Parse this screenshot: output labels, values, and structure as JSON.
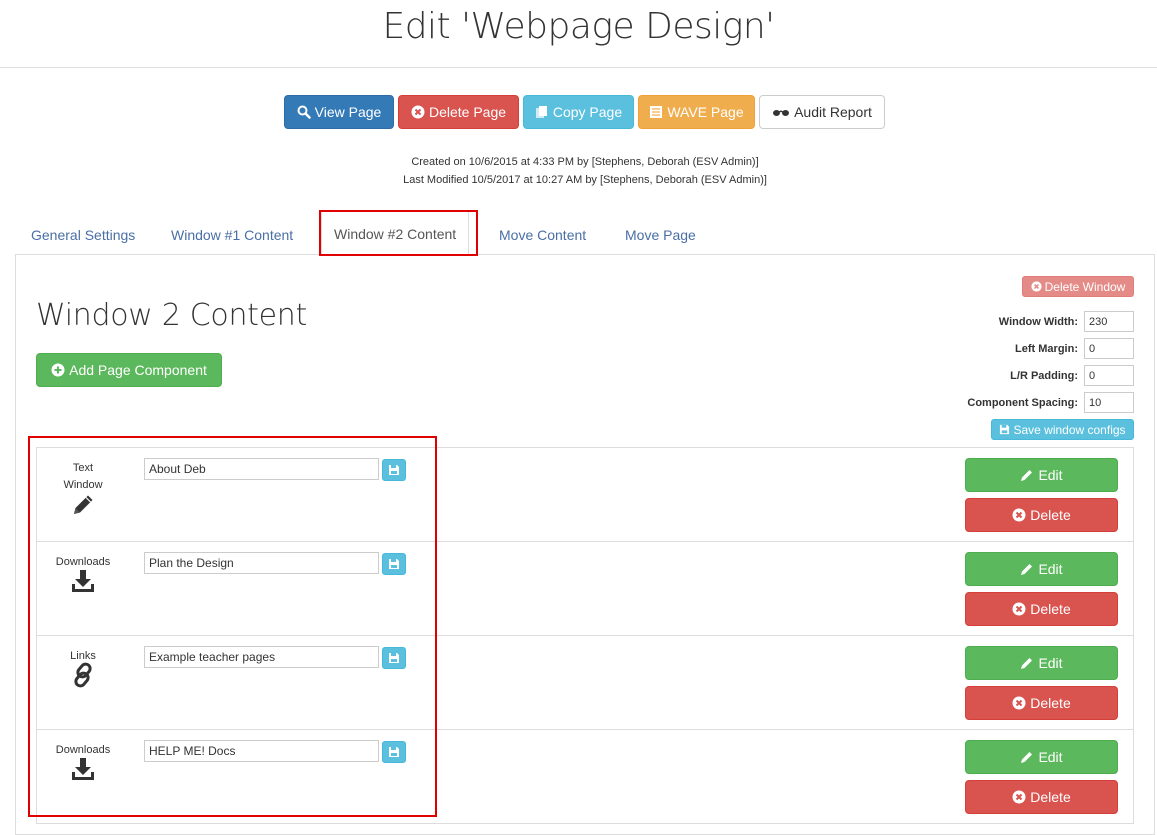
{
  "page": {
    "title": "Edit 'Webpage Design'"
  },
  "toolbar": {
    "view_page": "View Page",
    "delete_page": "Delete Page",
    "copy_page": "Copy Page",
    "wave_page": "WAVE Page",
    "audit_report": "Audit Report"
  },
  "meta": {
    "created": "Created on 10/6/2015 at 4:33 PM by [Stephens, Deborah (ESV Admin)]",
    "modified": "Last Modified 10/5/2017 at 10:27 AM by [Stephens, Deborah (ESV Admin)]"
  },
  "tabs": [
    {
      "label": "General Settings"
    },
    {
      "label": "Window #1 Content"
    },
    {
      "label": "Window #2 Content"
    },
    {
      "label": "Move Content"
    },
    {
      "label": "Move Page"
    }
  ],
  "window": {
    "title": "Window 2 Content",
    "add_component": "Add Page Component",
    "delete_window": "Delete Window",
    "width_label": "Window Width:",
    "width_value": "230",
    "margin_label": "Left Margin:",
    "margin_value": "0",
    "padding_label": "L/R Padding:",
    "padding_value": "0",
    "spacing_label": "Component Spacing:",
    "spacing_value": "10",
    "save_configs": "Save window configs"
  },
  "components": [
    {
      "type": "Text Window",
      "icon": "pencil-icon",
      "name": "About Deb"
    },
    {
      "type": "Downloads",
      "icon": "download-icon",
      "name": "Plan the Design"
    },
    {
      "type": "Links",
      "icon": "link-icon",
      "name": "Example teacher pages"
    },
    {
      "type": "Downloads",
      "icon": "download-icon",
      "name": "HELP ME! Docs"
    }
  ],
  "actions": {
    "edit": "Edit",
    "delete": "Delete"
  },
  "colors": {
    "primary": "#337ab7",
    "danger": "#d9534f",
    "info": "#5bc0de",
    "warning": "#f0ad4e",
    "success": "#5cb85c",
    "highlight": "#e00000"
  }
}
